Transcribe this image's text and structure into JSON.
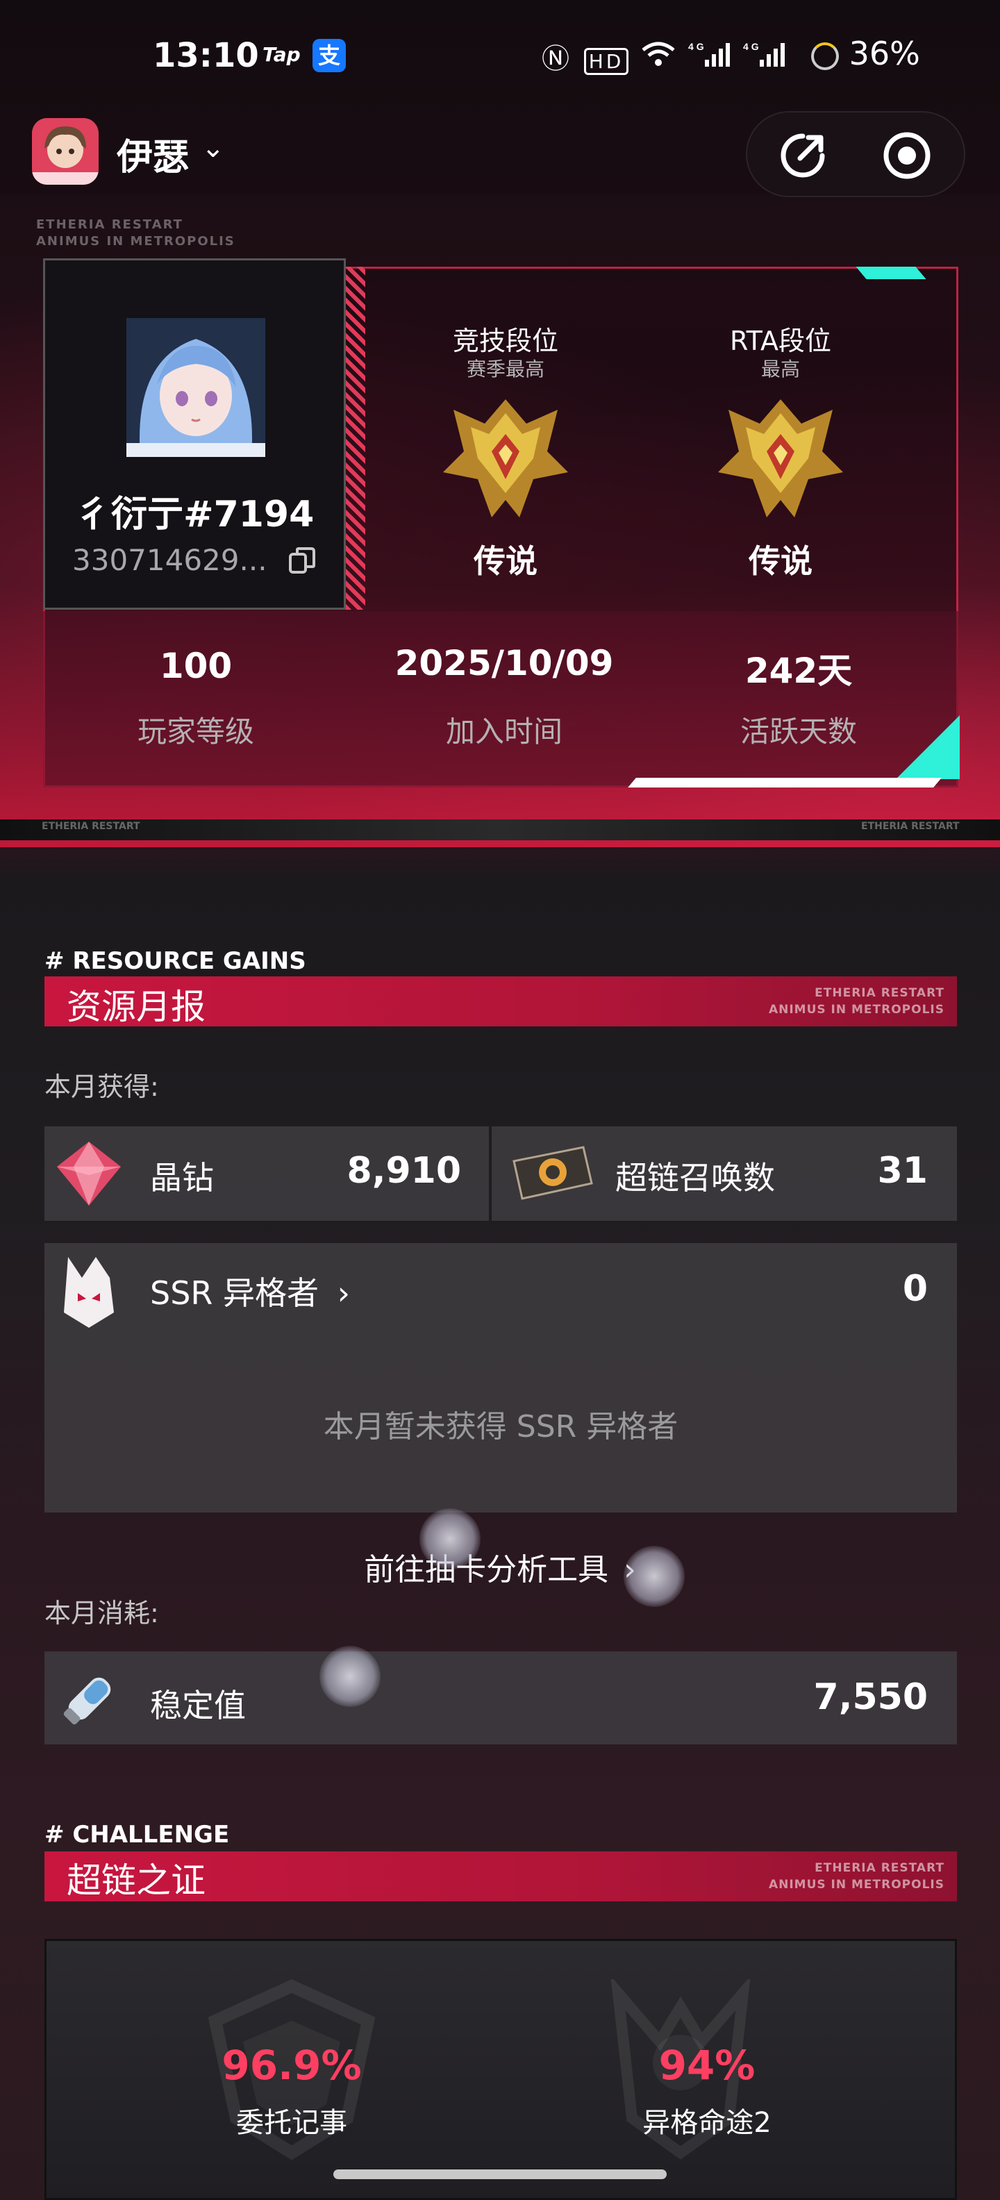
{
  "status_bar": {
    "time": "13:10",
    "tap_label": "Tap",
    "alipay_label": "支",
    "icons": [
      "nfc-icon",
      "hd-icon",
      "wifi-icon",
      "signal-4g-icon",
      "signal-4g-icon"
    ],
    "battery": "36%"
  },
  "header": {
    "game_name": "伊瑟",
    "caret": "⌄",
    "share_icon": "share-icon",
    "record_icon": "record-icon"
  },
  "hero": {
    "bg_text_line1": "ETHERIA RESTART",
    "bg_text_line2": "ANIMUS IN METROPOLIS",
    "bottom_label": "ETHERIA RESTART"
  },
  "profile": {
    "name": "彳衍亍#7194",
    "id": "330714629...",
    "copy_icon": "copy-icon"
  },
  "ranks": [
    {
      "label": "竞技段位",
      "sub": "赛季最高",
      "tier": "传说"
    },
    {
      "label": "RTA段位",
      "sub": "最高",
      "tier": "传说"
    }
  ],
  "stats": [
    {
      "value": "100",
      "label": "玩家等级"
    },
    {
      "value": "2025/10/09",
      "label": "加入时间"
    },
    {
      "value": "242天",
      "label": "活跃天数"
    }
  ],
  "resource_section": {
    "tag": "# RESOURCE GAINS",
    "title": "资源月报",
    "deco1": "ETHERIA RESTART",
    "deco2": "ANIMUS IN METROPOLIS",
    "gained_label": "本月获得:",
    "gains": [
      {
        "label": "晶钻",
        "value": "8,910"
      },
      {
        "label": "超链召唤数",
        "value": "31"
      }
    ],
    "ssr": {
      "label": "SSR 异格者",
      "chevron": "›",
      "value": "0",
      "empty_text": "本月暂未获得 SSR 异格者",
      "link_text": "前往抽卡分析工具",
      "link_chevron": "›"
    },
    "spent_label": "本月消耗:",
    "spent": [
      {
        "label": "稳定值",
        "value": "7,550"
      }
    ]
  },
  "challenge_section": {
    "tag": "# CHALLENGE",
    "title": "超链之证",
    "deco1": "ETHERIA RESTART",
    "deco2": "ANIMUS IN METROPOLIS",
    "items": [
      {
        "percent": "96.9%",
        "label": "委托记事"
      },
      {
        "percent": "94%",
        "label": "异格命途2"
      }
    ]
  },
  "colors": {
    "accent_red": "#c8163f",
    "accent_cyan": "#2ff0d8",
    "percent_red": "#ff3f62"
  }
}
